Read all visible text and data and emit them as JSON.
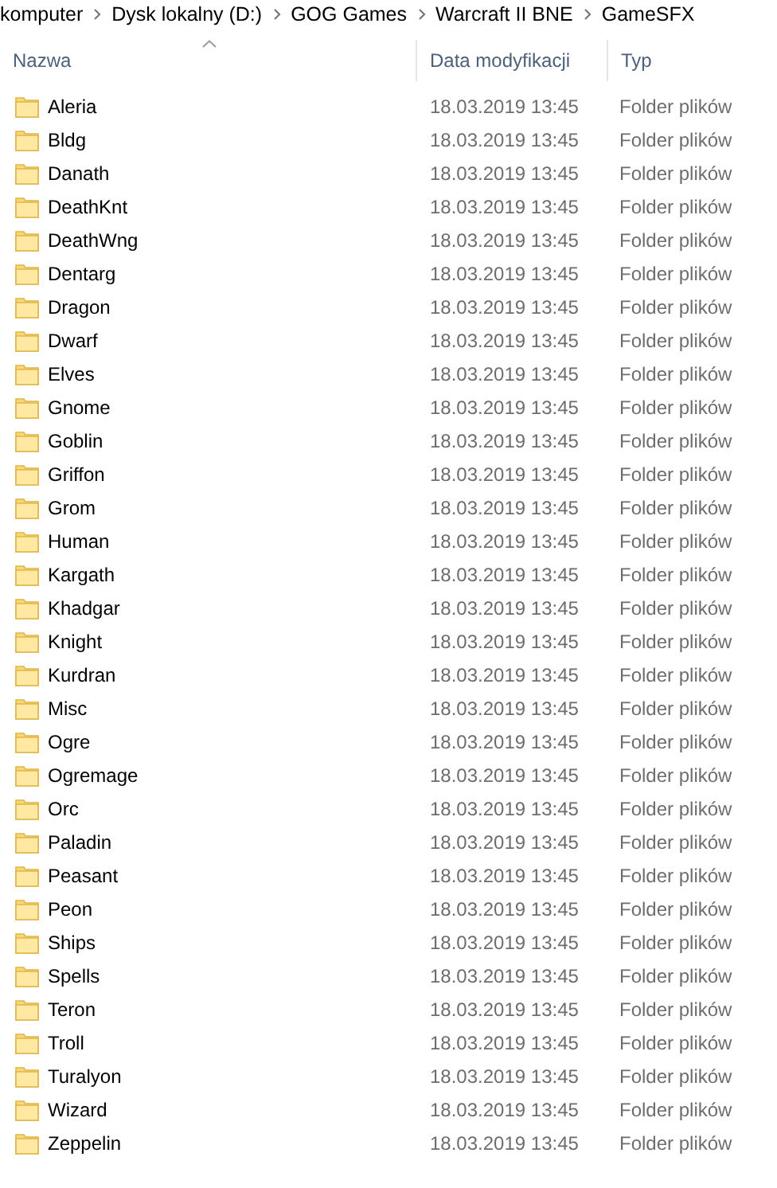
{
  "breadcrumb": [
    "komputer",
    "Dysk lokalny (D:)",
    "GOG Games",
    "Warcraft II BNE",
    "GameSFX"
  ],
  "table": {
    "columns": [
      {
        "label": "Nazwa",
        "sorted": true
      },
      {
        "label": "Data modyfikacji",
        "sorted": false
      },
      {
        "label": "Typ",
        "sorted": false
      }
    ],
    "rows": [
      {
        "name": "Aleria",
        "date": "18.03.2019 13:45",
        "type": "Folder plików"
      },
      {
        "name": "Bldg",
        "date": "18.03.2019 13:45",
        "type": "Folder plików"
      },
      {
        "name": "Danath",
        "date": "18.03.2019 13:45",
        "type": "Folder plików"
      },
      {
        "name": "DeathKnt",
        "date": "18.03.2019 13:45",
        "type": "Folder plików"
      },
      {
        "name": "DeathWng",
        "date": "18.03.2019 13:45",
        "type": "Folder plików"
      },
      {
        "name": "Dentarg",
        "date": "18.03.2019 13:45",
        "type": "Folder plików"
      },
      {
        "name": "Dragon",
        "date": "18.03.2019 13:45",
        "type": "Folder plików"
      },
      {
        "name": "Dwarf",
        "date": "18.03.2019 13:45",
        "type": "Folder plików"
      },
      {
        "name": "Elves",
        "date": "18.03.2019 13:45",
        "type": "Folder plików"
      },
      {
        "name": "Gnome",
        "date": "18.03.2019 13:45",
        "type": "Folder plików"
      },
      {
        "name": "Goblin",
        "date": "18.03.2019 13:45",
        "type": "Folder plików"
      },
      {
        "name": "Griffon",
        "date": "18.03.2019 13:45",
        "type": "Folder plików"
      },
      {
        "name": "Grom",
        "date": "18.03.2019 13:45",
        "type": "Folder plików"
      },
      {
        "name": "Human",
        "date": "18.03.2019 13:45",
        "type": "Folder plików"
      },
      {
        "name": "Kargath",
        "date": "18.03.2019 13:45",
        "type": "Folder plików"
      },
      {
        "name": "Khadgar",
        "date": "18.03.2019 13:45",
        "type": "Folder plików"
      },
      {
        "name": "Knight",
        "date": "18.03.2019 13:45",
        "type": "Folder plików"
      },
      {
        "name": "Kurdran",
        "date": "18.03.2019 13:45",
        "type": "Folder plików"
      },
      {
        "name": "Misc",
        "date": "18.03.2019 13:45",
        "type": "Folder plików"
      },
      {
        "name": "Ogre",
        "date": "18.03.2019 13:45",
        "type": "Folder plików"
      },
      {
        "name": "Ogremage",
        "date": "18.03.2019 13:45",
        "type": "Folder plików"
      },
      {
        "name": "Orc",
        "date": "18.03.2019 13:45",
        "type": "Folder plików"
      },
      {
        "name": "Paladin",
        "date": "18.03.2019 13:45",
        "type": "Folder plików"
      },
      {
        "name": "Peasant",
        "date": "18.03.2019 13:45",
        "type": "Folder plików"
      },
      {
        "name": "Peon",
        "date": "18.03.2019 13:45",
        "type": "Folder plików"
      },
      {
        "name": "Ships",
        "date": "18.03.2019 13:45",
        "type": "Folder plików"
      },
      {
        "name": "Spells",
        "date": "18.03.2019 13:45",
        "type": "Folder plików"
      },
      {
        "name": "Teron",
        "date": "18.03.2019 13:45",
        "type": "Folder plików"
      },
      {
        "name": "Troll",
        "date": "18.03.2019 13:45",
        "type": "Folder plików"
      },
      {
        "name": "Turalyon",
        "date": "18.03.2019 13:45",
        "type": "Folder plików"
      },
      {
        "name": "Wizard",
        "date": "18.03.2019 13:45",
        "type": "Folder plików"
      },
      {
        "name": "Zeppelin",
        "date": "18.03.2019 13:45",
        "type": "Folder plików"
      }
    ]
  }
}
